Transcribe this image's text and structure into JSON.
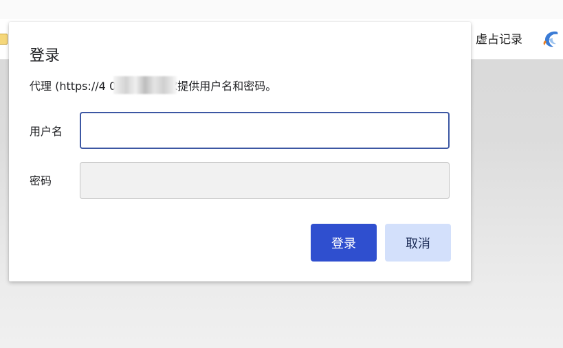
{
  "browser": {
    "bookmark_label": "虚占记录",
    "ext_icon": "dolphin-icon"
  },
  "dialog": {
    "title": "登录",
    "description": "代理 (https://4          00.180) 要求提供用户名和密码。",
    "username_label": "用户名",
    "username_value": "",
    "password_label": "密码",
    "password_value": "",
    "login_button": "登录",
    "cancel_button": "取消"
  },
  "colors": {
    "primary": "#2f4fcf",
    "secondary": "#d3e0fb",
    "focus_border": "#3c57a3"
  }
}
